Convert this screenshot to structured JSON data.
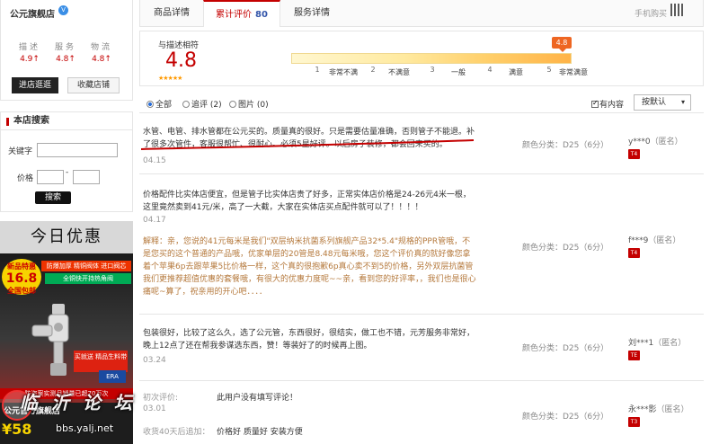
{
  "shop": {
    "name": "公元旗舰店",
    "badge": "V",
    "ratings": [
      {
        "label": "描述",
        "value": "4.9↑"
      },
      {
        "label": "服务",
        "value": "4.8↑"
      },
      {
        "label": "物流",
        "value": "4.8↑"
      }
    ],
    "enter_label": "进店逛逛",
    "fav_label": "收藏店铺"
  },
  "search": {
    "title": "本店搜索",
    "keyword_label": "关键字",
    "price_label": "价格",
    "price_dash": "-",
    "button_label": "搜索"
  },
  "promo": {
    "title": "今日优惠",
    "new_label": "新品特惠",
    "price": "16.8",
    "price_note": "全国包邮",
    "banner1": "防爆加厚 精铜阀体 进口阀芯",
    "banner2": "全铜快开持热角阀",
    "sold": "买就送 精品生料带",
    "strip": "防盗案实测月销量已超70万次",
    "official": "公元官方旗舰店",
    "official2": "ERA 公元正品",
    "big": "¥58",
    "era": "ERA"
  },
  "tabs": [
    {
      "label": "商品详情"
    },
    {
      "label": "累计评价",
      "count": "80"
    },
    {
      "label": "服务详情"
    }
  ],
  "mobile_buy": "手机购买",
  "score": {
    "label": "与描述相符",
    "value": "4.8",
    "stars": "★★★★★",
    "marker": "4.8",
    "ticks": [
      "1",
      "2",
      "3",
      "4",
      "5"
    ],
    "levels": [
      "非常不满",
      "不满意",
      "一般",
      "满意",
      "非常满意"
    ]
  },
  "filters": {
    "options": [
      {
        "label": "全部",
        "checked": true
      },
      {
        "label": "追评 (2)",
        "checked": false
      },
      {
        "label": "图片 (0)",
        "checked": false
      }
    ],
    "has_content_label": "有内容",
    "sort_label": "按默认",
    "sort_arrow": "▾"
  },
  "reviews": [
    {
      "text": "水管、电管、排水管都在公元买的。质量真的很好。只是需要估量准确，否则管子不能退。补了很多次管件，客服很帮忙、很耐心。必须5星好评。以后房子装修，都会回来买的。",
      "date": "04.15",
      "sku": "颜色分类：D25（6分）",
      "user": "y***0",
      "anon": "（匿名）",
      "level": "T4"
    },
    {
      "text": "价格配件比实体店便宜，但是管子比实体店贵了好多，正常实体店价格是24-26元4米一根，这里竟然卖到41元/米，高了一大截，大家在实体店买点配件就可以了！！！！",
      "date": "04.17",
      "reply": "解释：亲，您说的41元每米是我们\"双层纳米抗菌系列旗舰产品32*5.4\"规格的PPR管哦，不是您买的这个普通的产品哦，优家单层的20管是8.48元每米哦，您这个评价真的就好像您拿着个苹果6p去跟苹果5比价格一样，这个真的很抱歉6p真心卖不到5的价格，另外双层抗菌管我们更推荐超值优惠的套餐哦，有很大的优惠力度呢~~亲，看到您的好评率，，我们也是很心痛呢~算了，祝亲用的开心吧．．．．",
      "sku": "颜色分类：D25（6分）",
      "user": "f***9",
      "anon": "（匿名）",
      "level": "T4"
    },
    {
      "text": "包装很好，比较了这么久，选了公元管，东西很好，很结实，做工也不错，元芳服务非常好，晚上12点了还在帮我参谋选东西，赞！等装好了的时候再上图。",
      "date": "03.24",
      "sku": "颜色分类：D25（6分）",
      "user": "刘***1",
      "anon": "（匿名）",
      "level": "TE"
    },
    {
      "text_label": "初次评价:",
      "text": "此用户没有填写评论！",
      "date": "03.01",
      "follow_label": "收货40天后追加：",
      "follow": "价格好 质量好 安装方便",
      "sku": "颜色分类：D25（6分）",
      "user": "永***影",
      "anon": "（匿名）",
      "level": "T3"
    }
  ],
  "watermark": {
    "text": "临 沂 论 坛",
    "url": "bbs.yalj.net"
  },
  "colors": {
    "accent": "#c40000",
    "reply": "#b5793c",
    "link": "#3355aa"
  }
}
